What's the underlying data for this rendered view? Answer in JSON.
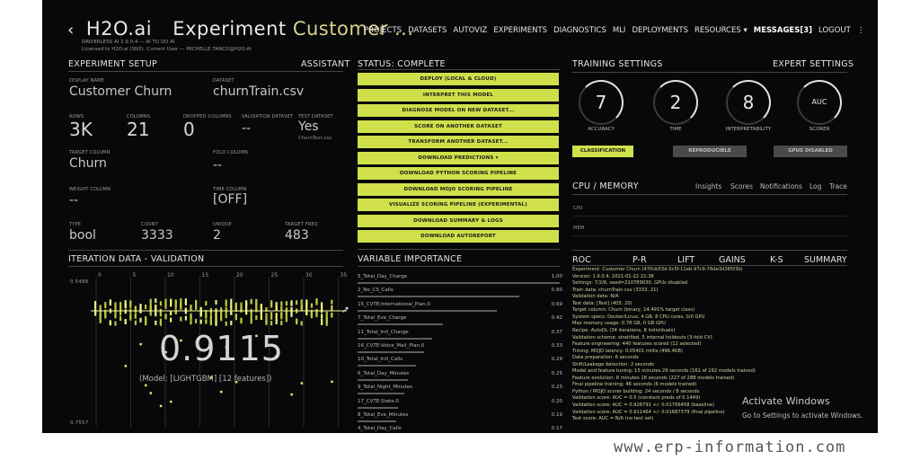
{
  "header": {
    "back_glyph": "‹",
    "brand": "H2O.ai",
    "experiment_label": "Experiment",
    "experiment_name": "Customer ...",
    "sub_lines": [
      "DRIVERLESS AI 1.9.0.4 — AI TO DO AI",
      "Licensed to H2O.ai (SN3). Current User — MICHELLE.TANCO@H2O.AI"
    ]
  },
  "nav": {
    "items": [
      "PROJECTS",
      "DATASETS",
      "AUTOVIZ",
      "EXPERIMENTS",
      "DIAGNOSTICS",
      "MLI",
      "DEPLOYMENTS",
      "RESOURCES ▾",
      "MESSAGES[3]",
      "LOGOUT",
      "⋮"
    ]
  },
  "setup": {
    "title": "EXPERIMENT SETUP",
    "assistant": "ASSISTANT",
    "display_name_label": "DISPLAY NAME",
    "display_name": "Customer Churn",
    "dataset_label": "DATASET",
    "dataset": "churnTrain.csv",
    "rows_label": "ROWS",
    "rows": "3K",
    "columns_label": "COLUMNS",
    "columns": "21",
    "dropped_label": "DROPPED COLUMNS",
    "dropped": "0",
    "validation_label": "VALIDATION DATASET",
    "validation": "--",
    "test_label": "TEST DATASET",
    "test": "Yes",
    "test_sub": "ChurnTest.csv",
    "target_label": "TARGET COLUMN",
    "target": "Churn",
    "fold_label": "FOLD COLUMN",
    "fold": "--",
    "weight_label": "WEIGHT COLUMN",
    "weight": "--",
    "time_label": "TIME COLUMN",
    "time": "[OFF]",
    "type_label": "TYPE",
    "type": "bool",
    "count_label": "COUNT",
    "count": "3333",
    "unique_label": "UNIQUE",
    "unique": "2",
    "freq_label": "TARGET FREQ",
    "freq": "483"
  },
  "status": {
    "title": "STATUS: COMPLETE",
    "buttons": [
      "DEPLOY (LOCAL & CLOUD)",
      "INTERPRET THIS MODEL",
      "DIAGNOSE MODEL ON NEW DATASET...",
      "SCORE ON ANOTHER DATASET",
      "TRANSFORM ANOTHER DATASET...",
      "DOWNLOAD PREDICTIONS ▾",
      "DOWNLOAD PYTHON SCORING PIPELINE",
      "DOWNLOAD MOJO SCORING PIPELINE",
      "VISUALIZE SCORING PIPELINE (EXPERIMENTAL)",
      "DOWNLOAD SUMMARY & LOGS",
      "DOWNLOAD AUTOREPORT"
    ]
  },
  "training": {
    "title": "TRAINING SETTINGS",
    "expert": "EXPERT SETTINGS",
    "gauges": [
      {
        "value": "7",
        "label": "ACCURACY"
      },
      {
        "value": "2",
        "label": "TIME"
      },
      {
        "value": "8",
        "label": "INTERPRETABILITY"
      },
      {
        "value": "AUC",
        "label": "SCORER"
      }
    ],
    "classification": "CLASSIFICATION",
    "reproducible": "REPRODUCIBLE",
    "gpus": "GPUS DISABLED",
    "accent": "#cfe04a"
  },
  "cpu": {
    "title": "CPU / MEMORY",
    "tabs": [
      "Insights",
      "Scores",
      "Notifications",
      "Log",
      "Trace"
    ],
    "cpu_label": "CPU",
    "mem_label": "MEM"
  },
  "iteration": {
    "title": "ITERATION DATA - VALIDATION",
    "ticks": [
      "0",
      "5",
      "10",
      "15",
      "20",
      "25",
      "30",
      "35"
    ],
    "ymax": "0.5488",
    "ymin": "0.7557",
    "score": "0.9115",
    "model": "(Model: [LIGHTGBM] [12 features])"
  },
  "varimp": {
    "title": "VARIABLE IMPORTANCE",
    "rows": [
      {
        "name": "5_Total_Day_Charge",
        "value": "1.00",
        "frac": 1.0
      },
      {
        "name": "2_No_CS_Calls",
        "value": "0.80",
        "frac": 0.8
      },
      {
        "name": "15_CVTE:International_Plan.0",
        "value": "0.69",
        "frac": 0.69
      },
      {
        "name": "7_Total_Eve_Charge",
        "value": "0.42",
        "frac": 0.42
      },
      {
        "name": "11_Total_Intl_Charge",
        "value": "0.37",
        "frac": 0.37
      },
      {
        "name": "16_CVTE:Voice_Mail_Plan.0",
        "value": "0.33",
        "frac": 0.33
      },
      {
        "name": "10_Total_Intl_Calls",
        "value": "0.29",
        "frac": 0.29
      },
      {
        "name": "6_Total_Day_Minutes",
        "value": "0.25",
        "frac": 0.25
      },
      {
        "name": "9_Total_Night_Minutes",
        "value": "0.23",
        "frac": 0.23
      },
      {
        "name": "17_CVTE:State.0",
        "value": "0.20",
        "frac": 0.2
      },
      {
        "name": "8_Total_Eve_Minutes",
        "value": "0.19",
        "frac": 0.19
      },
      {
        "name": "4_Total_Day_Calls",
        "value": "0.17",
        "frac": 0.17
      }
    ]
  },
  "summary": {
    "tabs": [
      "ROC",
      "P-R",
      "LIFT",
      "GAINS",
      "K-S",
      "SUMMARY"
    ],
    "lines": [
      "Experiment: Customer Churn (470cb53d-5c5f-11eb-97c9-76de3d385f3b)",
      "  Version: 1.9.0.4, 2021-01-22 22:38",
      "  Settings: 7/2/8, seed=210789030, GPUs disabled",
      "  Train data: churnTrain.csv (3333, 21)",
      "  Validation data: N/A",
      "  Test data: [Test] (405, 20)",
      "  Target column: Churn (binary, 14.491% target class)",
      "System specs: Docker/Linux, 4 GB, 8 CPU cores, 0/0 GPU",
      "  Max memory usage: 0.78 GB, 0 GB GPU",
      "Recipe: AutoDL (34 iterations, 8 individuals)",
      "  Validation scheme: stratified, 5 internal holdouts (3-fold CV)",
      "  Feature engineering: 440 features scored (12 selected)",
      "Timing: MOJO latency: 0.05401 millis (496.4KB)",
      "  Data preparation: 6 seconds",
      "  Shift/Leakage detection: 2 seconds",
      "  Model and feature tuning: 15 minutes 29 seconds (161 of 192 models trained)",
      "  Feature evolution: 8 minutes 18 seconds (227 of 288 models trained)",
      "  Final pipeline training: 46 seconds (6 models trained)",
      "  Python / MOJO scorer building: 24 seconds / 8 seconds",
      "Validation score: AUC = 0.5 (constant preds of 0.1449)",
      "Validation score: AUC = 0.926791 +/- 0.01766458 (baseline)",
      "Validation score: AUC = 0.911464 +/- 0.01687379 (final pipeline)",
      "Test score:       AUC = N/A (no test set)"
    ]
  },
  "overlay": {
    "activate_title": "Activate Windows",
    "activate_sub": "Go to Settings to activate Windows.",
    "watermark": "www.erp-information.com"
  }
}
